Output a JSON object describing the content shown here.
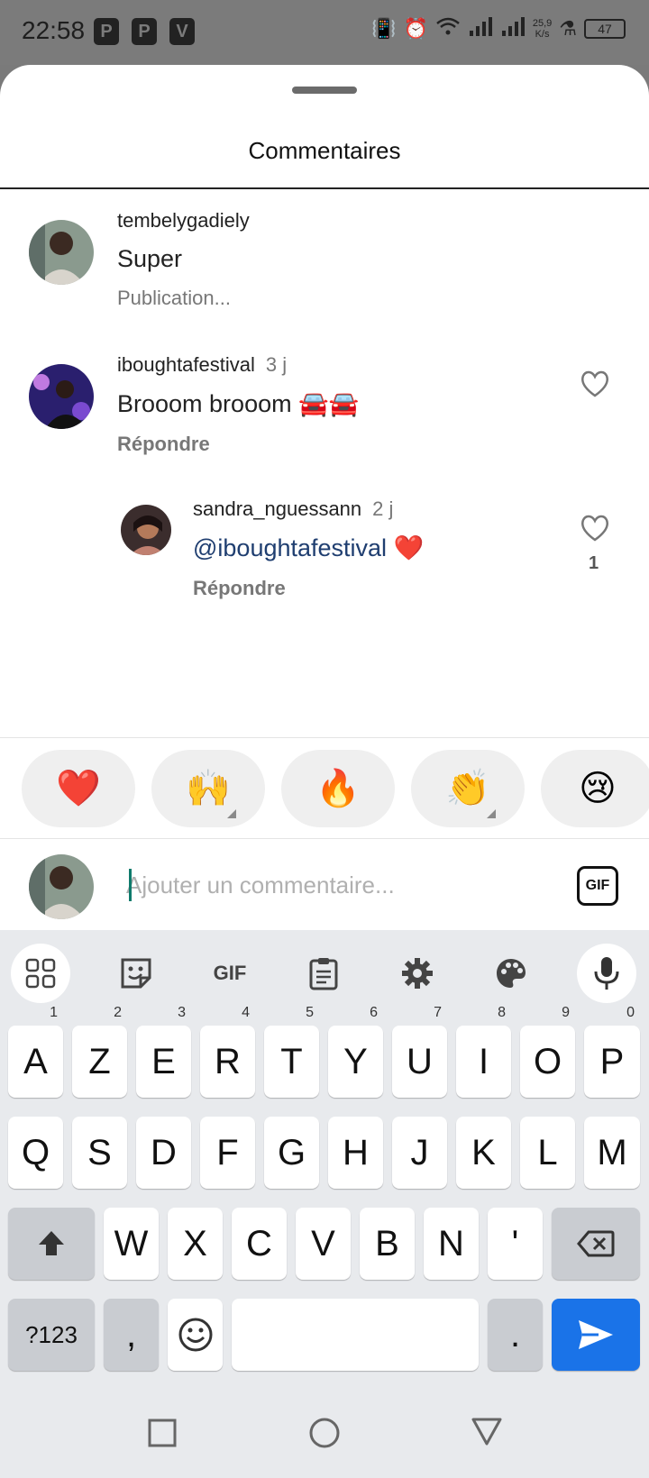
{
  "status_bar": {
    "time": "22:58",
    "app_icons": [
      "P",
      "P",
      "V"
    ],
    "net_speed_value": "25,9",
    "net_speed_unit": "K/s",
    "battery": "47"
  },
  "sheet": {
    "title": "Commentaires"
  },
  "comments": [
    {
      "username": "tembelygadiely",
      "age": "",
      "text": "Super",
      "meta": "Publication...",
      "avatar_color": "#6b7a6a"
    },
    {
      "username": "iboughtafestival",
      "age": "3 j",
      "text": "Brooom brooom 🚘🚘",
      "reply_label": "Répondre",
      "avatar_color": "#3b2a8a"
    },
    {
      "username": "sandra_nguessann",
      "age": "2 j",
      "mention": "@iboughtafestival",
      "text_suffix": " ❤️",
      "reply_label": "Répondre",
      "like_count": "1",
      "avatar_color": "#4a3a3a"
    }
  ],
  "emoji_bar": [
    "❤️",
    "🙌",
    "🔥",
    "👏",
    "😢"
  ],
  "composer": {
    "placeholder": "Ajouter un commentaire...",
    "gif_label": "GIF"
  },
  "keyboard": {
    "toolbar_gif": "GIF",
    "row1": [
      "A",
      "Z",
      "E",
      "R",
      "T",
      "Y",
      "U",
      "I",
      "O",
      "P"
    ],
    "row1_hints": [
      "1",
      "2",
      "3",
      "4",
      "5",
      "6",
      "7",
      "8",
      "9",
      "0"
    ],
    "row2": [
      "Q",
      "S",
      "D",
      "F",
      "G",
      "H",
      "J",
      "K",
      "L",
      "M"
    ],
    "row3": [
      "W",
      "X",
      "C",
      "V",
      "B",
      "N",
      "'"
    ],
    "symbols_label": "?123",
    "comma": ",",
    "period": "."
  }
}
